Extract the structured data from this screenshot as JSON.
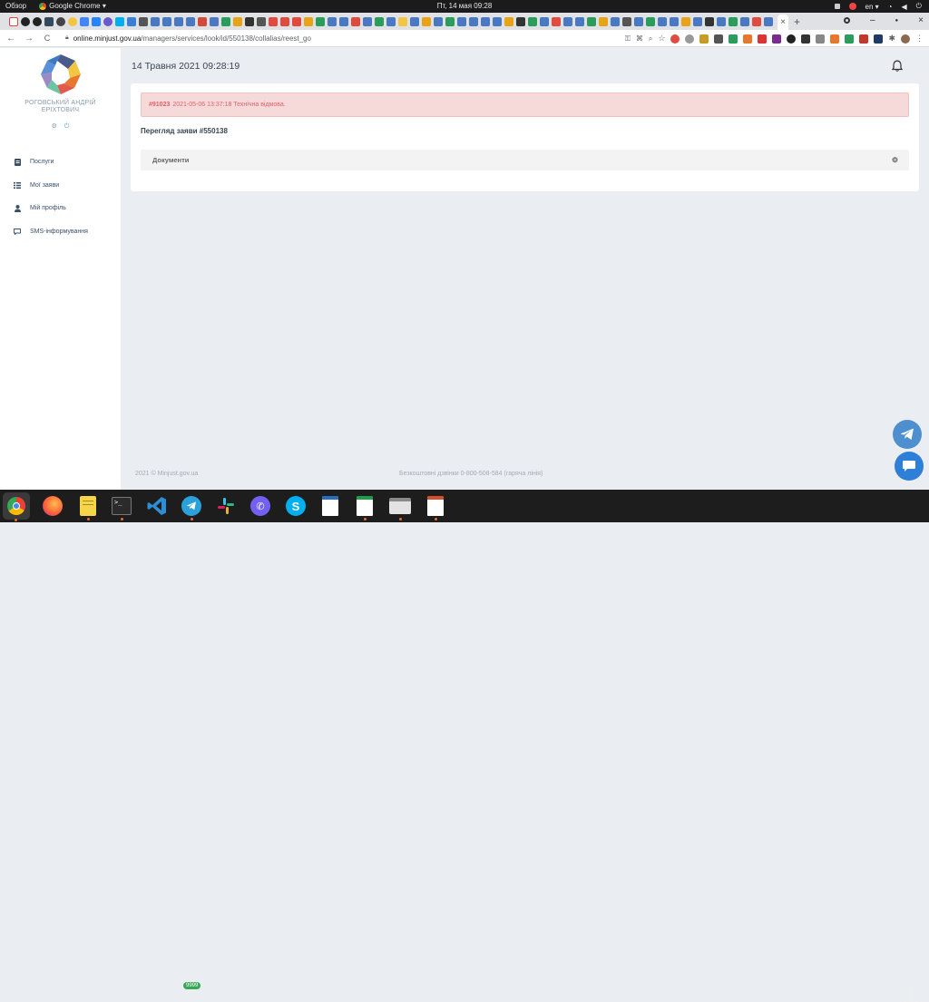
{
  "system_bar": {
    "activities": "Обзор",
    "app_name": "Google Chrome",
    "app_menu_arrow": "▾",
    "datetime": "Пт, 14 мая  09:28",
    "keyboard_layout": "en",
    "layout_arrow": "▾"
  },
  "browser": {
    "active_tab_close": "×",
    "new_tab": "+",
    "url_host": "online.minjust.gov.ua",
    "url_path": "/managers/services/look/id/550138/collalias/reest_go",
    "back": "←",
    "forward": "→",
    "reload": "C"
  },
  "sidebar": {
    "user_name_line1": "РОГОВСЬКИЙ АНДРІЙ",
    "user_name_line2": "ЕРІХТОВИЧ",
    "settings_icon": "⚙",
    "power_icon": "⏻",
    "items": [
      {
        "label": "Послуги",
        "icon": "document-icon"
      },
      {
        "label": "Мої заяви",
        "icon": "list-icon"
      },
      {
        "label": "Мій профіль",
        "icon": "user-icon"
      },
      {
        "label": "SMS-інформування",
        "icon": "comment-icon"
      }
    ]
  },
  "main": {
    "date": "14 Травня 2021 09:28:19",
    "alert": {
      "id": "#91023",
      "text": "2021-05-06 13:37:18 Технічна відмова."
    },
    "heading": "Перегляд заяви #550138",
    "accordion_label": "Документи"
  },
  "footer": {
    "copyright": "2021 © Minjust.gov.ua",
    "hotline": "Безкоштовні дзвінки 0-800-508-584 (гаряча лінія)"
  },
  "dock": {
    "telegram_badge": "9999"
  },
  "colors": {
    "alert_bg": "#f6dada",
    "alert_text": "#e0626a",
    "page_bg": "#eaedf2",
    "sidebar_text": "#39506b"
  }
}
